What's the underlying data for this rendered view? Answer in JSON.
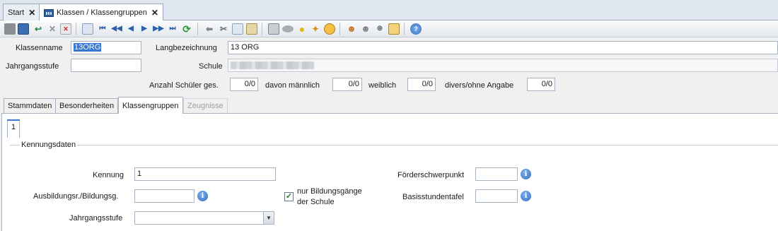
{
  "doc_tabs": [
    {
      "label": "Start",
      "close": "✕"
    },
    {
      "label": "Klassen / Klassengruppen",
      "close": "✕"
    }
  ],
  "header": {
    "klassenname_label": "Klassenname",
    "klassenname_value": "13ORG",
    "langbezeichnung_label": "Langbezeichnung",
    "langbezeichnung_value": "13 ORG",
    "jahrgangsstufe_label": "Jahrgangsstufe",
    "jahrgangsstufe_value": "",
    "schule_label": "Schule",
    "anzahl_label": "Anzahl Schüler ges.",
    "anzahl_value": "0/0",
    "maennlich_label": "davon männlich",
    "maennlich_value": "0/0",
    "weiblich_label": "weiblich",
    "weiblich_value": "0/0",
    "divers_label": "divers/ohne Angabe",
    "divers_value": "0/0"
  },
  "form_tabs": [
    {
      "label": "Stammdaten"
    },
    {
      "label": "Besonderheiten"
    },
    {
      "label": "Klassengruppen"
    },
    {
      "label": "Zeugnisse"
    }
  ],
  "sub_tab": {
    "label": "1"
  },
  "group": {
    "title": "Kennungsdaten",
    "kennung_label": "Kennung",
    "kennung_value": "1",
    "ausbildung_label": "Ausbildungsr./Bildungsg.",
    "ausbildung_value": "",
    "jahrgangsstufe_label": "Jahrgangsstufe",
    "jahrgangsstufe_value": "",
    "nur_bildung_label_1": "nur Bildungsgänge",
    "nur_bildung_label_2": "der Schule",
    "nur_bildung_checked": "✓",
    "foerder_label": "Förderschwerpunkt",
    "foerder_value": "",
    "basis_label": "Basisstundentafel",
    "basis_value": "",
    "info_glyph": "i",
    "dropdown_glyph": "▼"
  },
  "toolbar_icons": [
    "new-icon",
    "save-icon",
    "undo-icon",
    "delete-icon",
    "delete-record-icon",
    "copy-record-icon",
    "first-icon",
    "prev-page-icon",
    "prev-icon",
    "next-icon",
    "next-page-icon",
    "last-icon",
    "refresh-icon",
    "back-arrow-icon",
    "cut-icon",
    "copy-icon",
    "paste-icon",
    "print-icon",
    "eraser-icon",
    "bulb-icon",
    "clean-icon",
    "clock-icon",
    "users-icon",
    "user-group-icon",
    "search-icon",
    "edit-icon",
    "help-icon"
  ]
}
